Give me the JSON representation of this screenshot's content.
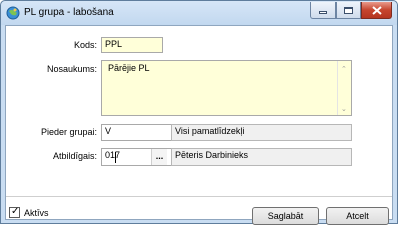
{
  "window": {
    "title": "PL grupa - labošana",
    "icon": "app-globe-icon",
    "controls": [
      "minimize-icon",
      "maximize-icon",
      "close-icon"
    ]
  },
  "form": {
    "kods": {
      "label": "Kods:",
      "value": "PPL"
    },
    "nosaukums": {
      "label": "Nosaukums:",
      "value": "Pārējie PL"
    },
    "pieder_grupai": {
      "label": "Pieder grupai:",
      "code": "V",
      "name": "Visi pamatlīdzekļi"
    },
    "atbildigais": {
      "label": "Atbildīgais:",
      "code": "017",
      "browse": "...",
      "name": "Pēteris Darbinieks"
    }
  },
  "aktivs": {
    "label": "Aktīvs",
    "checked": true
  },
  "buttons": {
    "save": "Saglabāt",
    "cancel": "Atcelt"
  },
  "colors": {
    "field_highlight": "#ffffd9",
    "readonly_bg": "#f0f0f0",
    "title_bar": "#c9ddf2"
  }
}
